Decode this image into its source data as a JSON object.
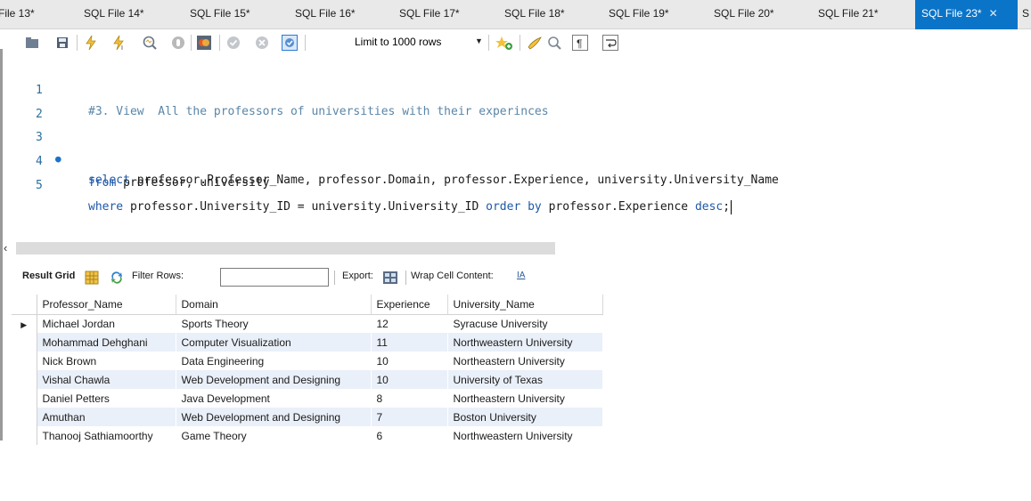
{
  "tabs": [
    {
      "label": "File 13*",
      "active": false
    },
    {
      "label": "SQL File 14*",
      "active": false
    },
    {
      "label": "SQL File 15*",
      "active": false
    },
    {
      "label": "SQL File 16*",
      "active": false
    },
    {
      "label": "SQL File 17*",
      "active": false
    },
    {
      "label": "SQL File 18*",
      "active": false
    },
    {
      "label": "SQL File 19*",
      "active": false
    },
    {
      "label": "SQL File 20*",
      "active": false
    },
    {
      "label": "SQL File 21*",
      "active": false
    },
    {
      "label": "SQL File 23*",
      "active": true
    },
    {
      "label": "S",
      "active": false
    }
  ],
  "toolbar": {
    "limit_label": "Limit to 1000 rows",
    "icons": [
      "open-folder-icon",
      "save-icon",
      "execute-icon",
      "execute-current-icon",
      "explain-icon",
      "stop-icon",
      "toggle-output-icon",
      "commit-icon",
      "rollback-icon",
      "autocommit-icon",
      "beautify-icon",
      "brush-icon",
      "find-icon",
      "invisible-chars-icon",
      "wrap-icon"
    ]
  },
  "editor": {
    "lines": [
      {
        "num": "1",
        "comment": "#3. View  All the professors of universities with their experinces"
      },
      {
        "num": "2"
      },
      {
        "num": "3",
        "kw": "select",
        "rest": " professor.Professor_Name, professor.Domain, professor.Experience, university.University_Name"
      },
      {
        "num": "4",
        "kw": "from",
        "rest": " professor, university"
      },
      {
        "num": "5",
        "kw": "where",
        "rest": " professor.University_ID = university.University_ID ",
        "kw2": "order by",
        "rest2": " professor.Experience ",
        "kw3": "desc",
        "tail": ";"
      }
    ]
  },
  "result_toolbar": {
    "result_grid": "Result Grid",
    "filter_rows": "Filter Rows:",
    "filter_value": "",
    "export": "Export:",
    "wrap": "Wrap Cell Content:",
    "wrap_icon_text": "IA"
  },
  "grid": {
    "columns": [
      "Professor_Name",
      "Domain",
      "Experience",
      "University_Name"
    ],
    "rows": [
      [
        "Michael Jordan",
        "Sports Theory",
        "12",
        "Syracuse University"
      ],
      [
        "Mohammad Dehghani",
        "Computer Visualization",
        "11",
        "Northweastern University"
      ],
      [
        "Nick Brown",
        "Data Engineering",
        "10",
        "Northeastern University"
      ],
      [
        "Vishal Chawla",
        "Web Development and Designing",
        "10",
        "University of Texas"
      ],
      [
        "Daniel Petters",
        "Java Development",
        "8",
        "Northeastern University"
      ],
      [
        "Amuthan",
        "Web Development and Designing",
        "7",
        "Boston University"
      ],
      [
        "Thanooj Sathiamoorthy",
        "Game Theory",
        "6",
        "Northweastern University"
      ]
    ]
  },
  "colors": {
    "active_tab": "#0a74c9",
    "keyword": "#1f58a8",
    "comment": "#5a86a8",
    "line_number": "#2b6f9e",
    "row_alt": "#eaf0f9"
  }
}
